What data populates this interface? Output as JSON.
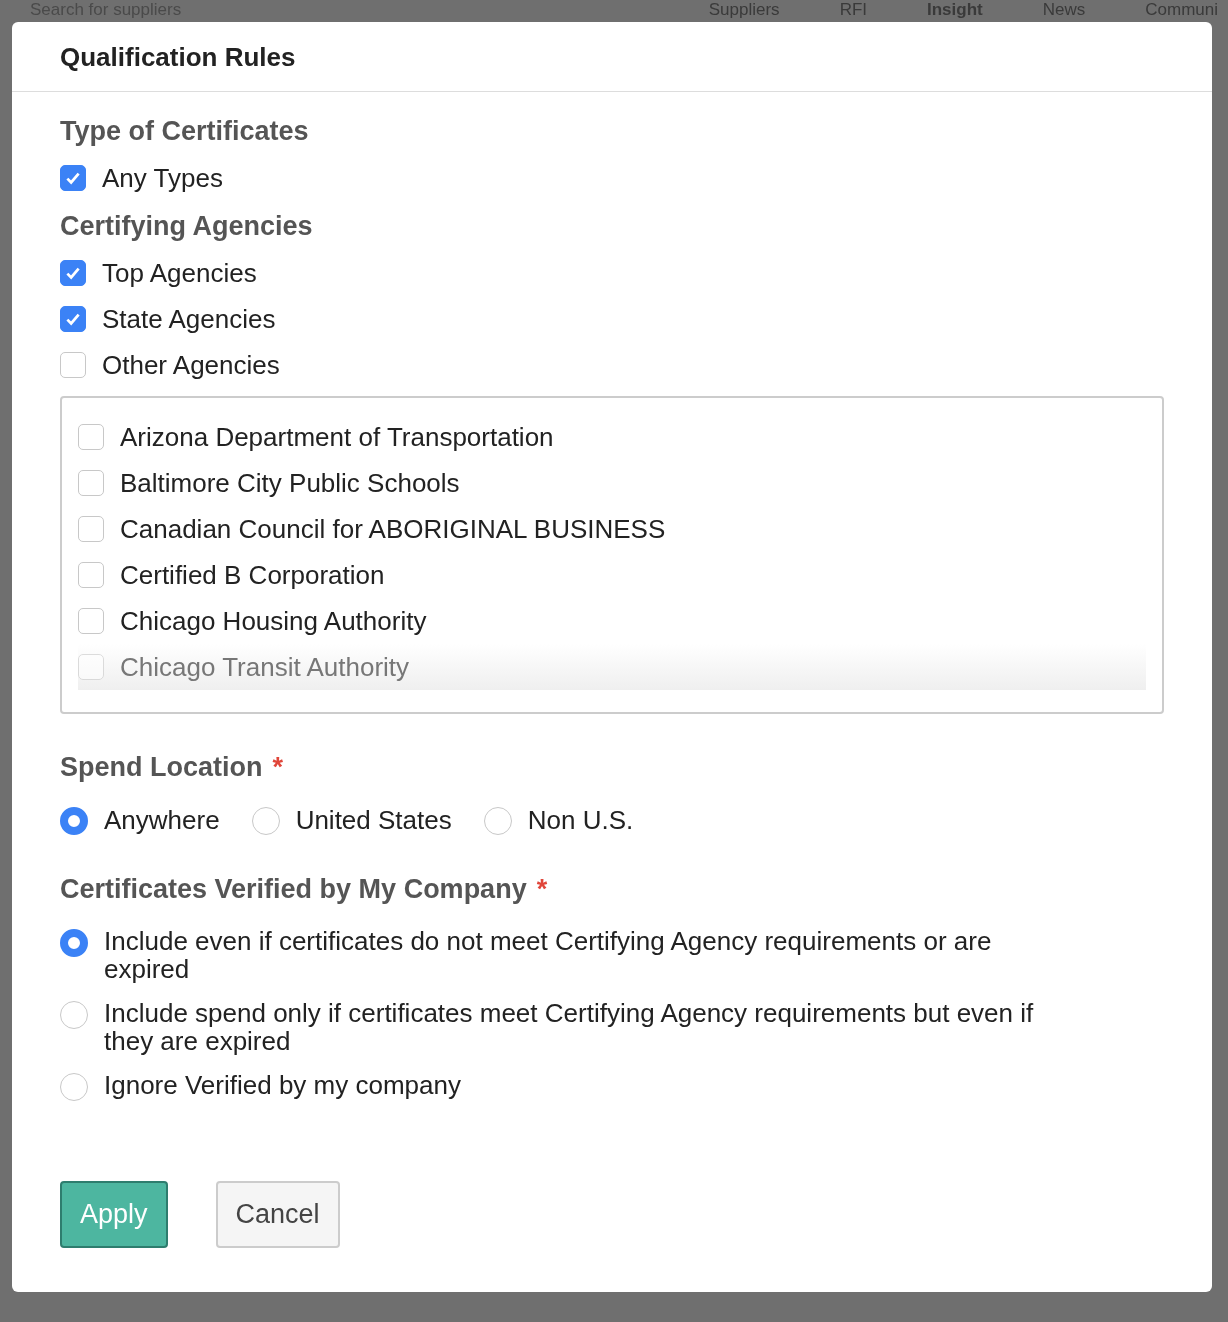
{
  "background_nav": {
    "search_placeholder": "Search for suppliers",
    "items": [
      {
        "label": "Suppliers",
        "selected": false
      },
      {
        "label": "RFI",
        "selected": false
      },
      {
        "label": "Insight",
        "selected": true
      },
      {
        "label": "News",
        "selected": false
      },
      {
        "label": "Communi",
        "selected": false
      }
    ]
  },
  "dialog": {
    "title": "Qualification Rules",
    "certificate_types": {
      "heading": "Type of Certificates",
      "options": [
        {
          "label": "Any Types",
          "checked": true
        }
      ]
    },
    "certifying_agencies": {
      "heading": "Certifying Agencies",
      "options": [
        {
          "label": "Top Agencies",
          "checked": true
        },
        {
          "label": "State Agencies",
          "checked": true
        },
        {
          "label": "Other Agencies",
          "checked": false
        }
      ],
      "agency_list": [
        {
          "label": "Arizona Department of Transportation",
          "checked": false
        },
        {
          "label": "Baltimore City Public Schools",
          "checked": false
        },
        {
          "label": "Canadian Council for ABORIGINAL BUSINESS",
          "checked": false
        },
        {
          "label": "Certified B Corporation",
          "checked": false
        },
        {
          "label": "Chicago Housing Authority",
          "checked": false
        },
        {
          "label": "Chicago Transit Authority",
          "checked": false
        }
      ]
    },
    "spend_location": {
      "heading": "Spend Location",
      "required_mark": "*",
      "options": [
        {
          "label": "Anywhere",
          "selected": true
        },
        {
          "label": "United States",
          "selected": false
        },
        {
          "label": "Non U.S.",
          "selected": false
        }
      ]
    },
    "verified_by_company": {
      "heading": "Certificates Verified by My Company",
      "required_mark": "*",
      "options": [
        {
          "label": "Include even if certificates do not meet Certifying Agency requirements or are expired",
          "selected": true
        },
        {
          "label": "Include spend only if certificates meet Certifying Agency requirements but even if they are expired",
          "selected": false
        },
        {
          "label": "Ignore Verified by my company",
          "selected": false
        }
      ]
    },
    "buttons": [
      {
        "label": "Apply",
        "kind": "primary"
      },
      {
        "label": "Cancel",
        "kind": "secondary"
      }
    ]
  }
}
